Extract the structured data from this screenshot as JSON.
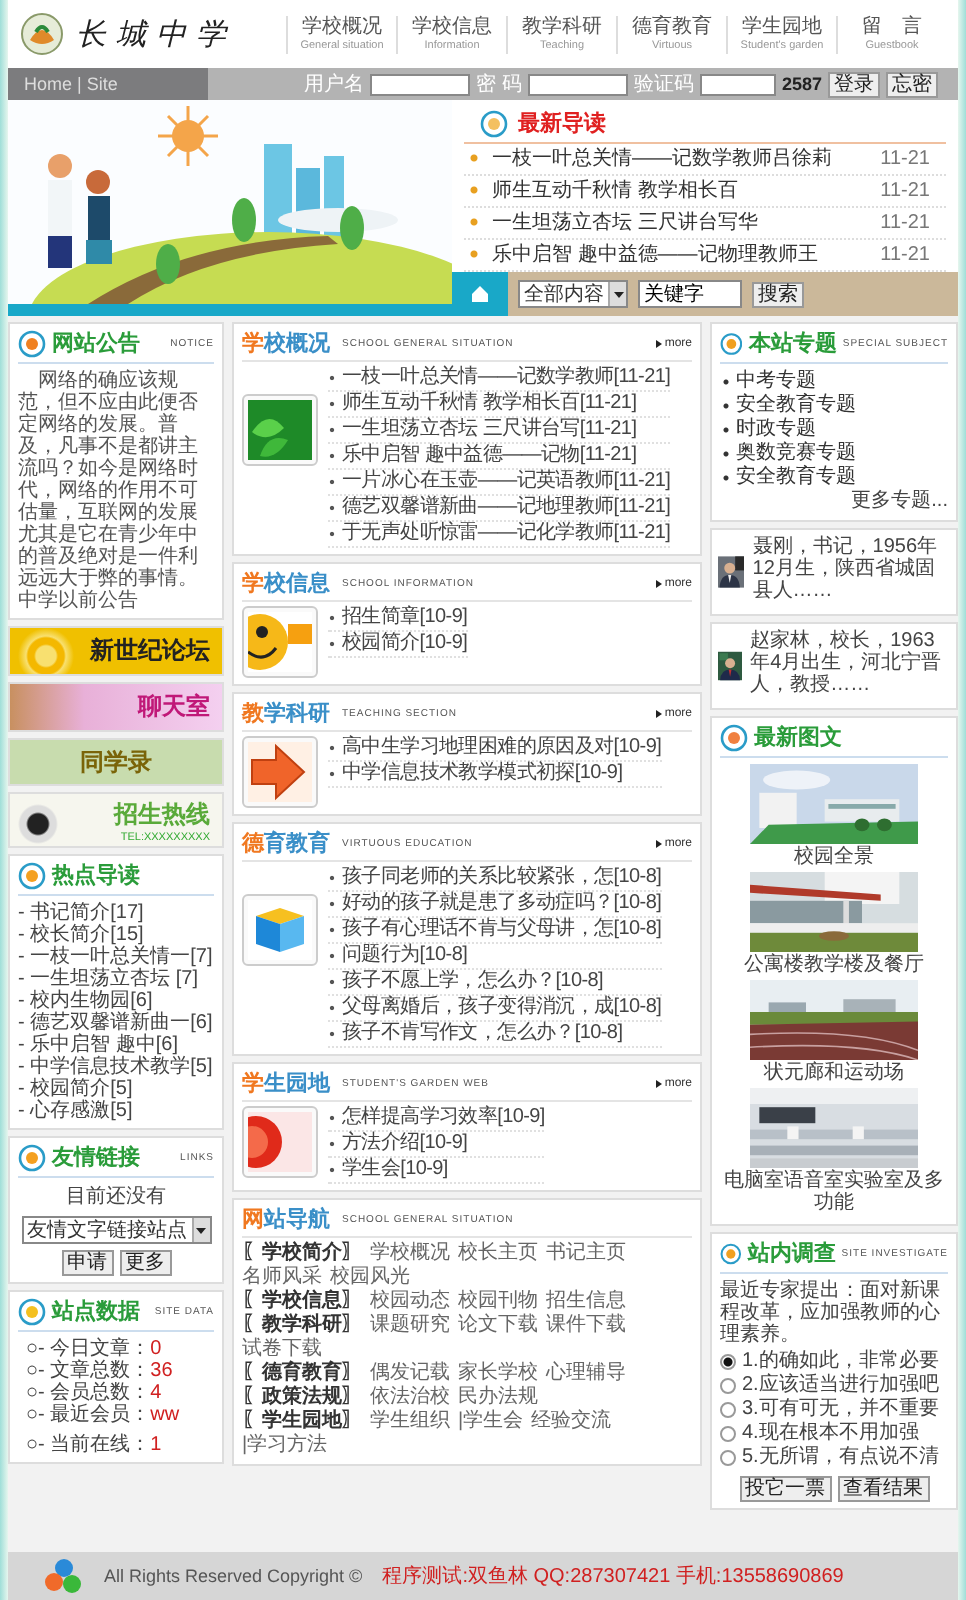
{
  "header": {
    "school_name": "长城中学",
    "nav": [
      {
        "label": "学校概况",
        "sub": "General situation"
      },
      {
        "label": "学校信息",
        "sub": "Information"
      },
      {
        "label": "教学科研",
        "sub": "Teaching"
      },
      {
        "label": "德育教育",
        "sub": "Virtuous"
      },
      {
        "label": "学生园地",
        "sub": "Student's garden"
      },
      {
        "label": "留　言",
        "sub": "Guestbook"
      }
    ]
  },
  "login_bar": {
    "home_site": "Home | Site",
    "username_label": "用户名",
    "password_label": "密 码",
    "captcha_label": "验证码",
    "captcha": "2587",
    "buttons": [
      "登录",
      "忘密"
    ]
  },
  "latest_reads": {
    "title": "最新导读",
    "items": [
      {
        "title": "一枝一叶总关情——记数学教师吕徐莉",
        "date": "11-21"
      },
      {
        "title": "师生互动千秋情 教学相长百",
        "date": "11-21"
      },
      {
        "title": "一生坦荡立杏坛 三尺讲台写华",
        "date": "11-21"
      },
      {
        "title": "乐中启智 趣中益德——记物理教师王",
        "date": "11-21"
      }
    ]
  },
  "search": {
    "scope": "全部内容",
    "keyword": "关键字",
    "button": "搜索"
  },
  "notice": {
    "title": "网站公告",
    "label": "NOTICE",
    "text": "网络的确应该规范，但不应由此便否定网络的发展。普及，凡事不是都讲主流吗？如今是网络时代，网络的作用不可估量，互联网的发展尤其是它在青少年中的普及绝对是一件利远远大于弊的事情。中学以前公告"
  },
  "promos": [
    {
      "kind": "forum",
      "text": "新世纪论坛"
    },
    {
      "kind": "chat",
      "text": "聊天室"
    },
    {
      "kind": "alumni",
      "text": "同学录"
    },
    {
      "kind": "hotline",
      "text": "招生热线",
      "sub": "TEL:XXXXXXXXX"
    }
  ],
  "hot_reads": {
    "title": "热点导读",
    "items": [
      "- 书记简介[17]",
      "- 校长简介[15]",
      "- 一枝一叶总关情一[7]",
      "- 一生坦荡立杏坛 [7]",
      "- 校内生物园[6]",
      "- 德艺双馨谱新曲一[6]",
      "- 乐中启智 趣中[6]",
      "- 中学信息技术教学[5]",
      "- 校园简介[5]",
      "- 心存感激[5]"
    ]
  },
  "links": {
    "title": "友情链接",
    "label": "LINKS",
    "empty": "目前还没有",
    "select": "友情文字链接站点",
    "buttons": [
      "申请",
      "更多"
    ]
  },
  "site_stats": {
    "title": "站点数据",
    "label": "SITE DATA",
    "rows": [
      {
        "label": "○- 今日文章：",
        "value": "0"
      },
      {
        "label": "○- 文章总数：",
        "value": "36"
      },
      {
        "label": "○- 会员总数：",
        "value": "4"
      },
      {
        "label": "○- 最近会员：",
        "value": "ww"
      },
      {
        "label": "○- 当前在线：",
        "value": "1"
      }
    ]
  },
  "sections": [
    {
      "kind": "leaf",
      "title": "学校概况",
      "label": "SCHOOL GENERAL SITUATION",
      "more": "more",
      "items": [
        "一枝一叶总关情——记数学教师[11-21]",
        "师生互动千秋情 教学相长百[11-21]",
        "一生坦荡立杏坛 三尺讲台写[11-21]",
        "乐中启智 趣中益德——记物[11-21]",
        "一片冰心在玉壶——记英语教师[11-21]",
        "德艺双馨谱新曲——记地理教师[11-21]",
        "于无声处听惊雷——记化学教师[11-21]"
      ]
    },
    {
      "kind": "eye",
      "title": "学校信息",
      "label": "SCHOOL INFORMATION",
      "more": "more",
      "items": [
        "招生简章[10-9]",
        "校园简介[10-9]"
      ]
    },
    {
      "kind": "arrow",
      "title": "教学科研",
      "label": "TEACHING SECTION",
      "more": "more",
      "items": [
        "高中生学习地理困难的原因及对[10-9]",
        "中学信息技术教学模式初探[10-9]"
      ]
    },
    {
      "kind": "cube",
      "title": "德育教育",
      "label": "VIRTUOUS EDUCATION",
      "more": "more",
      "items": [
        "孩子同老师的关系比较紧张，怎[10-8]",
        "好动的孩子就是患了多动症吗？[10-8]",
        "孩子有心理话不肯与父母讲，怎[10-8]",
        "问题行为[10-8]",
        "孩子不愿上学，怎么办？[10-8]",
        "父母离婚后，孩子变得消沉，成[10-8]",
        "孩子不肯写作文，怎么办？[10-8]"
      ]
    },
    {
      "kind": "disc",
      "title": "学生园地",
      "label": "STUDENT'S GARDEN WEB",
      "more": "more",
      "items": [
        "怎样提高学习效率[10-9]",
        "方法介绍[10-9]",
        "学生会[10-9]"
      ]
    }
  ],
  "site_nav": {
    "title": "网站导航",
    "label": "SCHOOL GENERAL SITUATION",
    "rows": [
      {
        "label": "〖学校简介〗",
        "links": [
          "学校概况",
          "校长主页",
          "书记主页",
          "名师风采",
          "校园风光"
        ]
      },
      {
        "label": "〖学校信息〗",
        "links": [
          "校园动态",
          "校园刊物",
          "招生信息"
        ]
      },
      {
        "label": "〖教学科研〗",
        "links": [
          "课题研究",
          "论文下载",
          "课件下载",
          "试卷下载"
        ]
      },
      {
        "label": "〖德育教育〗",
        "links": [
          "偶发记载",
          "家长学校",
          "心理辅导"
        ]
      },
      {
        "label": "〖政策法规〗",
        "links": [
          "依法治校",
          "民办法规"
        ]
      },
      {
        "label": "〖学生园地〗",
        "links": [
          "学生组织",
          "|学生会",
          "经验交流",
          "|学习方法"
        ]
      }
    ]
  },
  "topics": {
    "title": "本站专题",
    "label": "SPECIAL SUBJECT",
    "items": [
      "中考专题",
      "安全教育专题",
      "时政专题",
      "奥数竞赛专题",
      "安全教育专题"
    ],
    "more": "更多专题..."
  },
  "profiles": [
    {
      "text": "聂刚，书记，1956年12月生，陕西省城固县人……"
    },
    {
      "text": "赵家林，校长，1963年4月出生，河北宁晋人，教授……"
    }
  ],
  "gallery": {
    "title": "最新图文",
    "photos": [
      {
        "kind": "campus",
        "caption": "校园全景"
      },
      {
        "kind": "hall",
        "caption": "公寓楼教学楼及餐厅"
      },
      {
        "kind": "track",
        "caption": "状元廊和运动场"
      },
      {
        "kind": "lab",
        "caption": "电脑室语音室实验室及多功能"
      }
    ]
  },
  "poll": {
    "title": "站内调查",
    "label": "SITE INVESTIGATE",
    "question": "最近专家提出：面对新课程改革，应加强教师的心理素养。",
    "options": [
      {
        "label": "1.的确如此，非常必要",
        "selected": true
      },
      {
        "label": "2.应该适当进行加强吧",
        "selected": false
      },
      {
        "label": "3.可有可无，并不重要",
        "selected": false
      },
      {
        "label": "4.现在根本不用加强",
        "selected": false
      },
      {
        "label": "5.无所谓，有点说不清",
        "selected": false
      }
    ],
    "buttons": [
      "投它一票",
      "查看结果"
    ]
  },
  "footer": {
    "copyright": "All Rights Reserved Copyright ©",
    "contact": "程序测试:双鱼林  QQ:287307421  手机:13558690869"
  }
}
